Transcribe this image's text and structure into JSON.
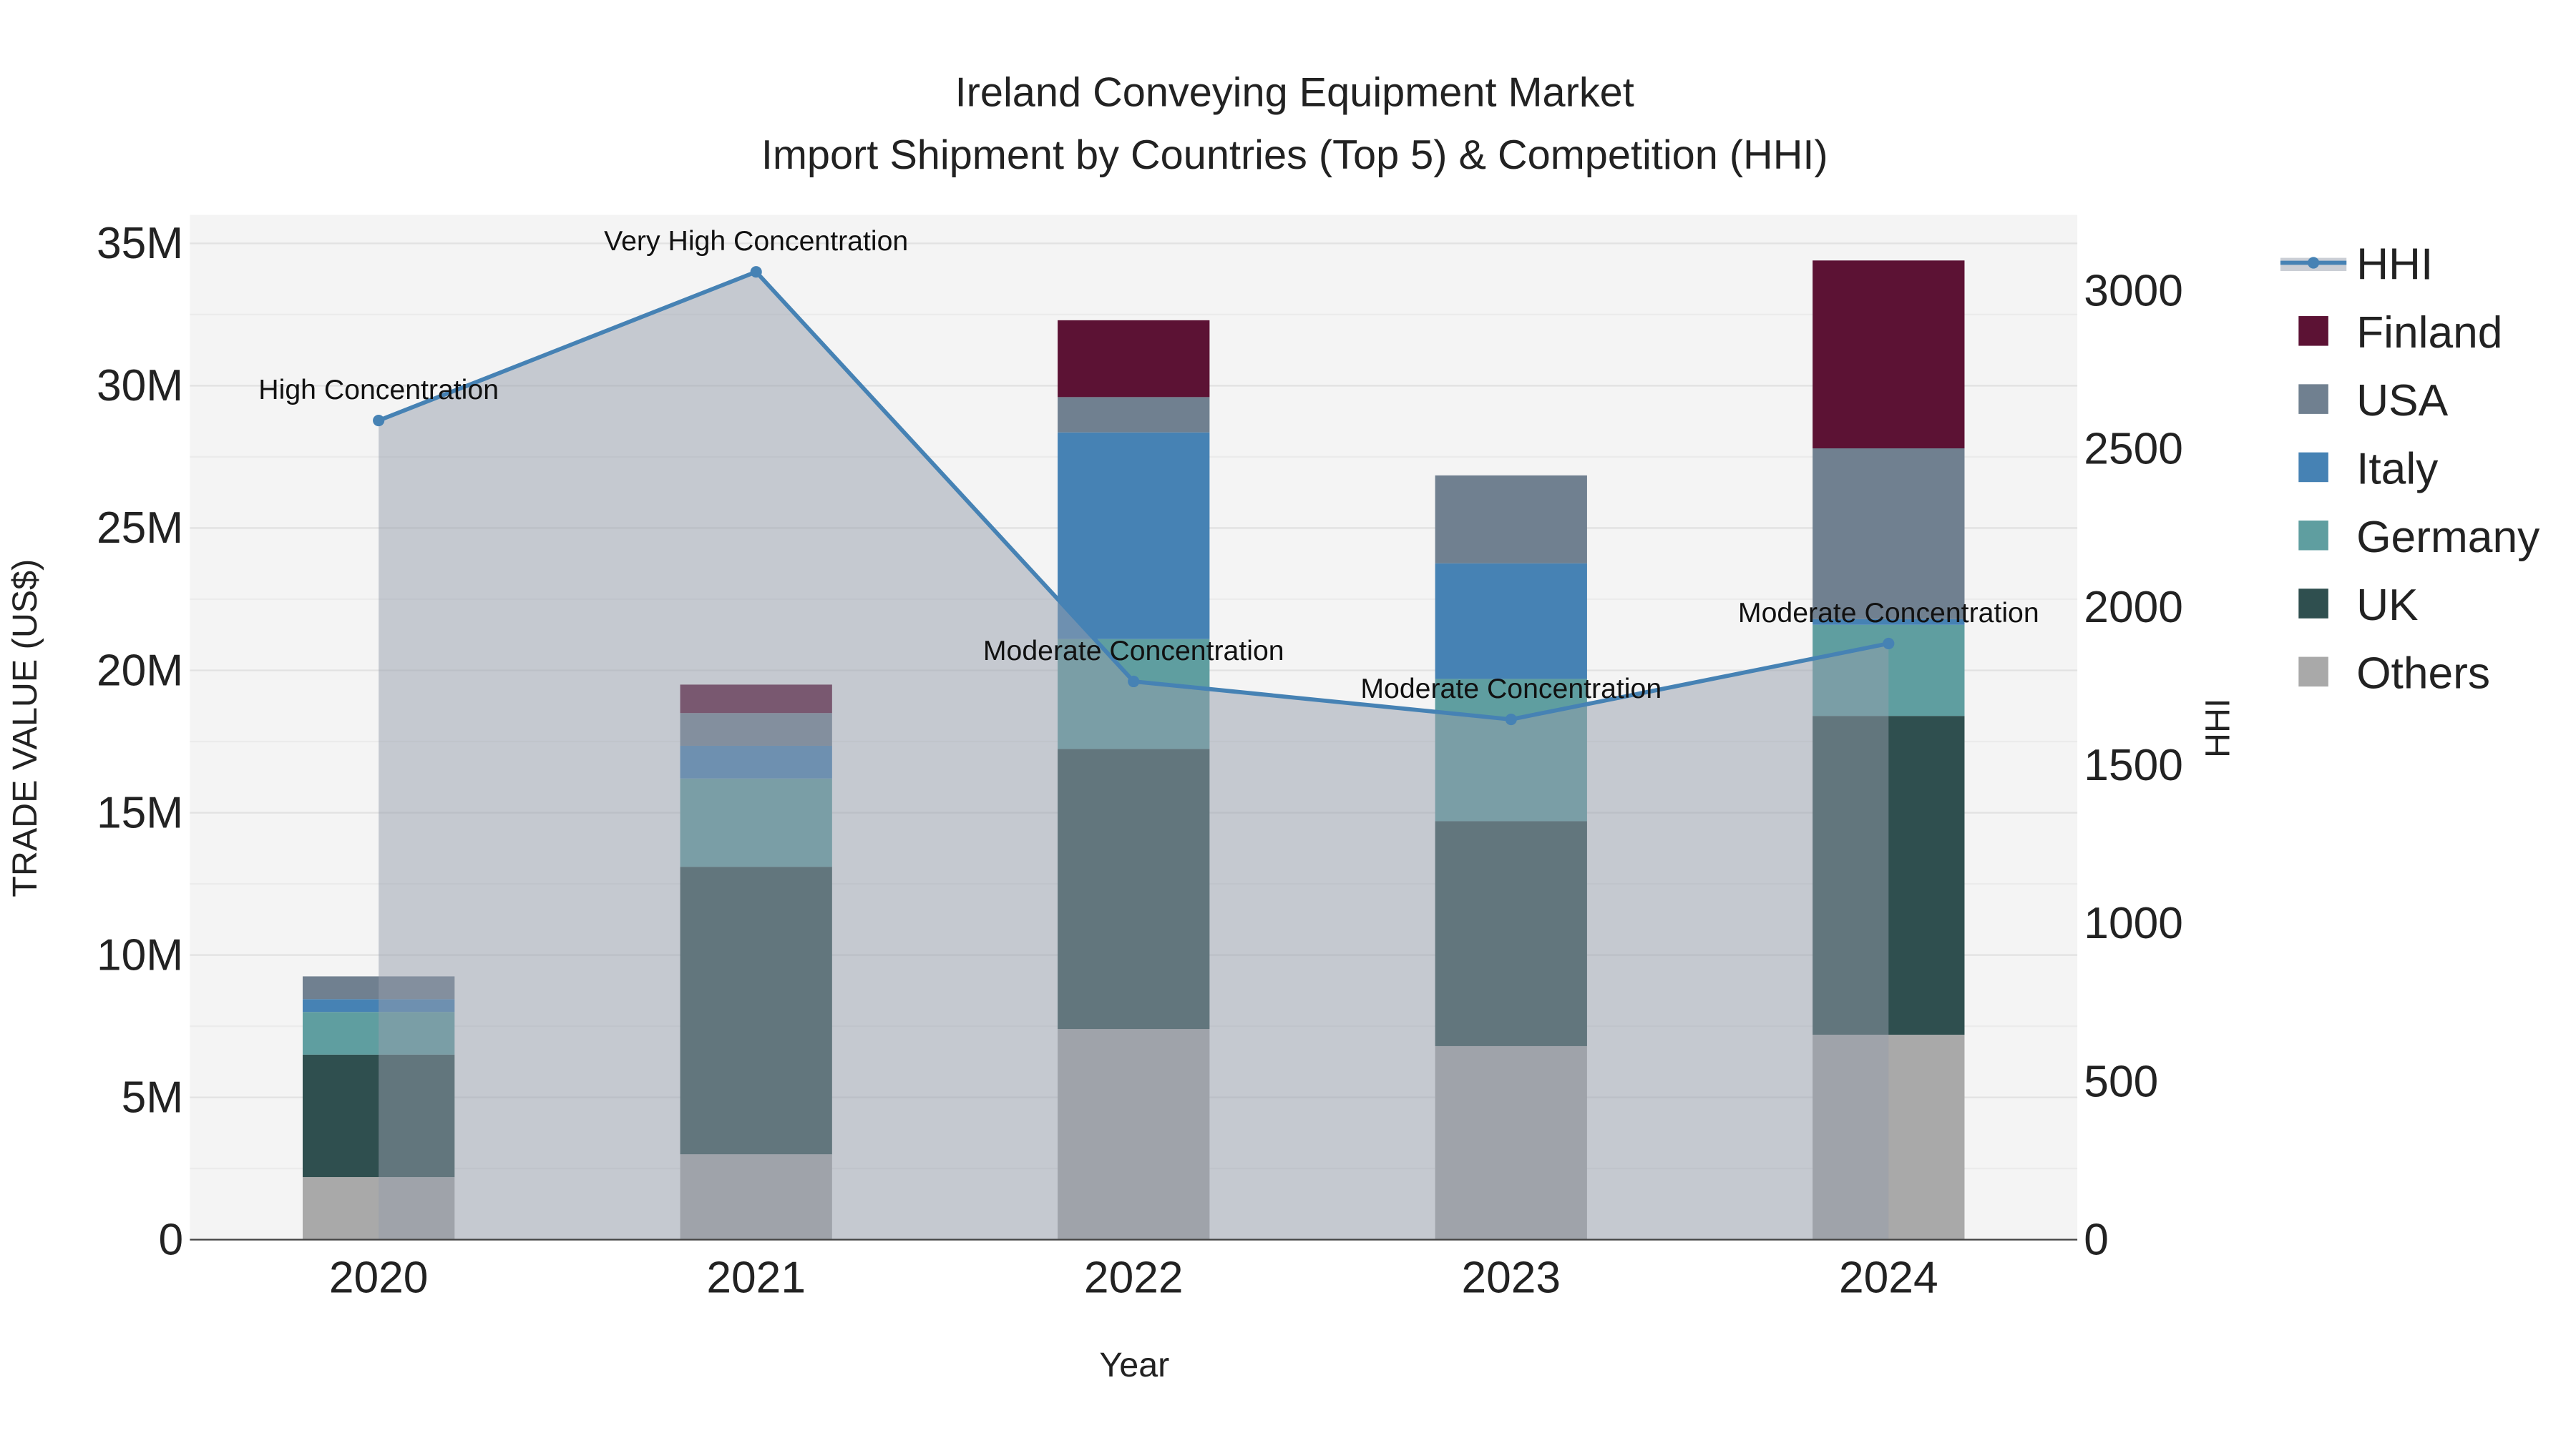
{
  "chart_data": {
    "type": "bar",
    "barmode": "stack",
    "title": "Ireland Conveying Equipment Market",
    "subtitle": "Import Shipment by Countries (Top 5) & Competition (HHI)",
    "xlabel": "Year",
    "ylabel": "TRADE VALUE (US$)",
    "y2label": "HHI",
    "categories": [
      "2020",
      "2021",
      "2022",
      "2023",
      "2024"
    ],
    "ylim": [
      0,
      36000000
    ],
    "y_ticks": [
      0,
      5000000,
      10000000,
      15000000,
      20000000,
      25000000,
      30000000,
      35000000
    ],
    "y_tick_labels": [
      "0",
      "5M",
      "10M",
      "15M",
      "20M",
      "25M",
      "30M",
      "35M"
    ],
    "y2lim": [
      0,
      3240
    ],
    "y2_ticks": [
      0,
      500,
      1000,
      1500,
      2000,
      2500,
      3000
    ],
    "y2_tick_labels": [
      "0",
      "500",
      "1000",
      "1500",
      "2000",
      "2500",
      "3000"
    ],
    "grid": true,
    "legend_position": "right",
    "series": [
      {
        "name": "Others",
        "color": "#a9a9a9",
        "values": [
          2200000,
          3000000,
          7400000,
          6800000,
          7200000
        ]
      },
      {
        "name": "UK",
        "color": "#2f4f4f",
        "values": [
          4300000,
          10100000,
          9840000,
          7900000,
          11200000
        ]
      },
      {
        "name": "Germany",
        "color": "#5f9ea0",
        "values": [
          1500000,
          3100000,
          3860000,
          5000000,
          3200000
        ]
      },
      {
        "name": "Italy",
        "color": "#4682b4",
        "values": [
          450000,
          1150000,
          7260000,
          4060000,
          200000
        ]
      },
      {
        "name": "USA",
        "color": "#708090",
        "values": [
          800000,
          1150000,
          1240000,
          3090000,
          6000000
        ]
      },
      {
        "name": "Finland",
        "color": "#5c1234",
        "values": [
          0,
          1000000,
          2700000,
          0,
          6600000
        ]
      }
    ],
    "hhi": {
      "name": "HHI",
      "color": "#4682b4",
      "values": [
        2590,
        3060,
        1765,
        1645,
        1885
      ],
      "annotations": [
        "High Concentration",
        "Very High Concentration",
        "Moderate Concentration",
        "Moderate Concentration",
        "Moderate Concentration"
      ]
    },
    "legend_order": [
      "HHI",
      "Finland",
      "USA",
      "Italy",
      "Germany",
      "UK",
      "Others"
    ]
  }
}
